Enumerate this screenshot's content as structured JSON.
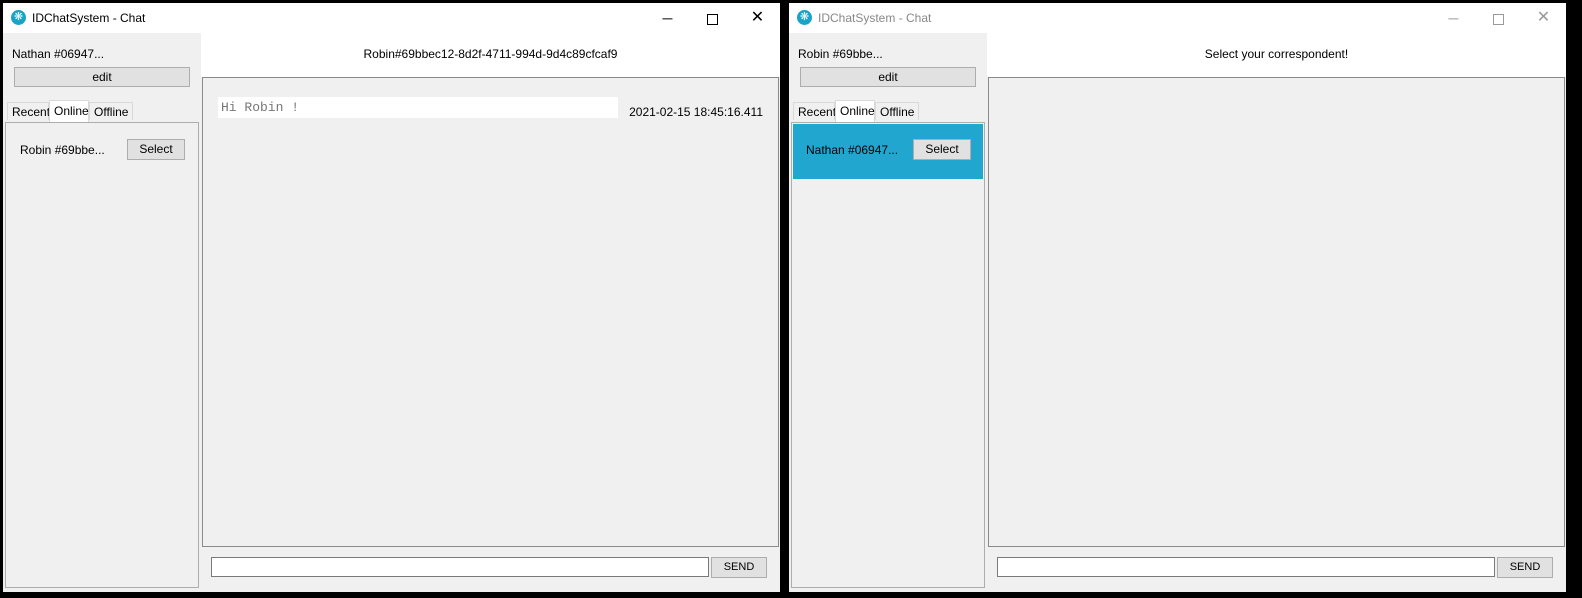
{
  "windows": [
    {
      "title": "IDChatSystem - Chat",
      "active": true,
      "controls": {
        "minimize": "─",
        "close": "✕"
      },
      "user_name": "Nathan #06947...",
      "edit_label": "edit",
      "tabs": [
        "Recent",
        "Online",
        "Offline"
      ],
      "active_tab": "Online",
      "contacts": [
        {
          "name": "Robin #69bbe...",
          "select_label": "Select",
          "selected": false
        }
      ],
      "header": "Robin#69bbec12-8d2f-4711-994d-9d4c89cfcaf9",
      "messages": [
        {
          "text": "Hi Robin !",
          "timestamp": "2021-02-15 18:45:16.411"
        }
      ],
      "input_value": "",
      "send_label": "SEND"
    },
    {
      "title": "IDChatSystem - Chat",
      "active": false,
      "controls": {
        "minimize": "─",
        "close": "✕"
      },
      "user_name": "Robin #69bbe...",
      "edit_label": "edit",
      "tabs": [
        "Recent",
        "Online",
        "Offline"
      ],
      "active_tab": "Online",
      "contacts": [
        {
          "name": "Nathan #06947...",
          "select_label": "Select",
          "selected": true
        }
      ],
      "header": "Select your correspondent!",
      "messages": [],
      "input_value": "",
      "send_label": "SEND"
    }
  ],
  "colors": {
    "selected_row": "#21a6cf",
    "app_icon": "#1aa3c8"
  }
}
